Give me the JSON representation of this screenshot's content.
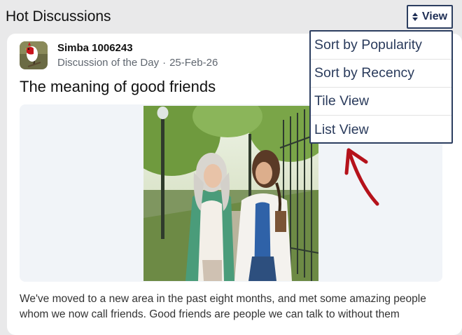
{
  "header": {
    "title": "Hot Discussions",
    "view_label": "View"
  },
  "post": {
    "author": "Simba 1006243",
    "category": "Discussion of the Day",
    "separator": "·",
    "date": "25-Feb-26",
    "title": "The meaning of good friends",
    "body": "We've moved to a new area in the past eight months, and met some amazing people whom we now call friends. Good friends are people we can talk to without them"
  },
  "menu": {
    "items": [
      {
        "label": "Sort by Popularity"
      },
      {
        "label": "Sort by Recency"
      },
      {
        "label": "Tile View"
      },
      {
        "label": "List View"
      }
    ]
  },
  "colors": {
    "accent": "#2c3e60",
    "annotation_arrow": "#b5121b"
  },
  "icons": {
    "view_button": "sort-updown-icon"
  }
}
